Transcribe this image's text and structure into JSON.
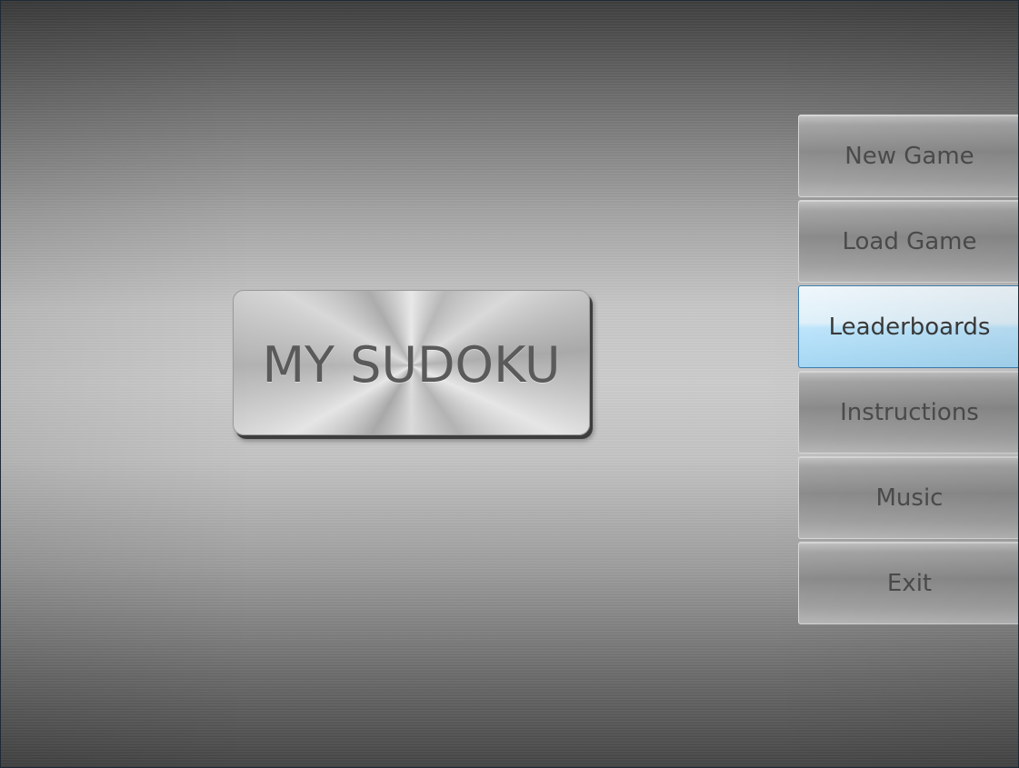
{
  "logo": {
    "text": "MY SUDOKU"
  },
  "menu": {
    "items": [
      {
        "label": "New Game",
        "active": false
      },
      {
        "label": "Load Game",
        "active": false
      },
      {
        "label": "Leaderboards",
        "active": true
      },
      {
        "label": "Instructions",
        "active": false
      },
      {
        "label": "Music",
        "active": false
      },
      {
        "label": "Exit",
        "active": false
      }
    ]
  },
  "colors": {
    "active_highlight": "#bee6fd",
    "active_border": "#3c7fb1",
    "button_text": "#4c4c4c"
  }
}
